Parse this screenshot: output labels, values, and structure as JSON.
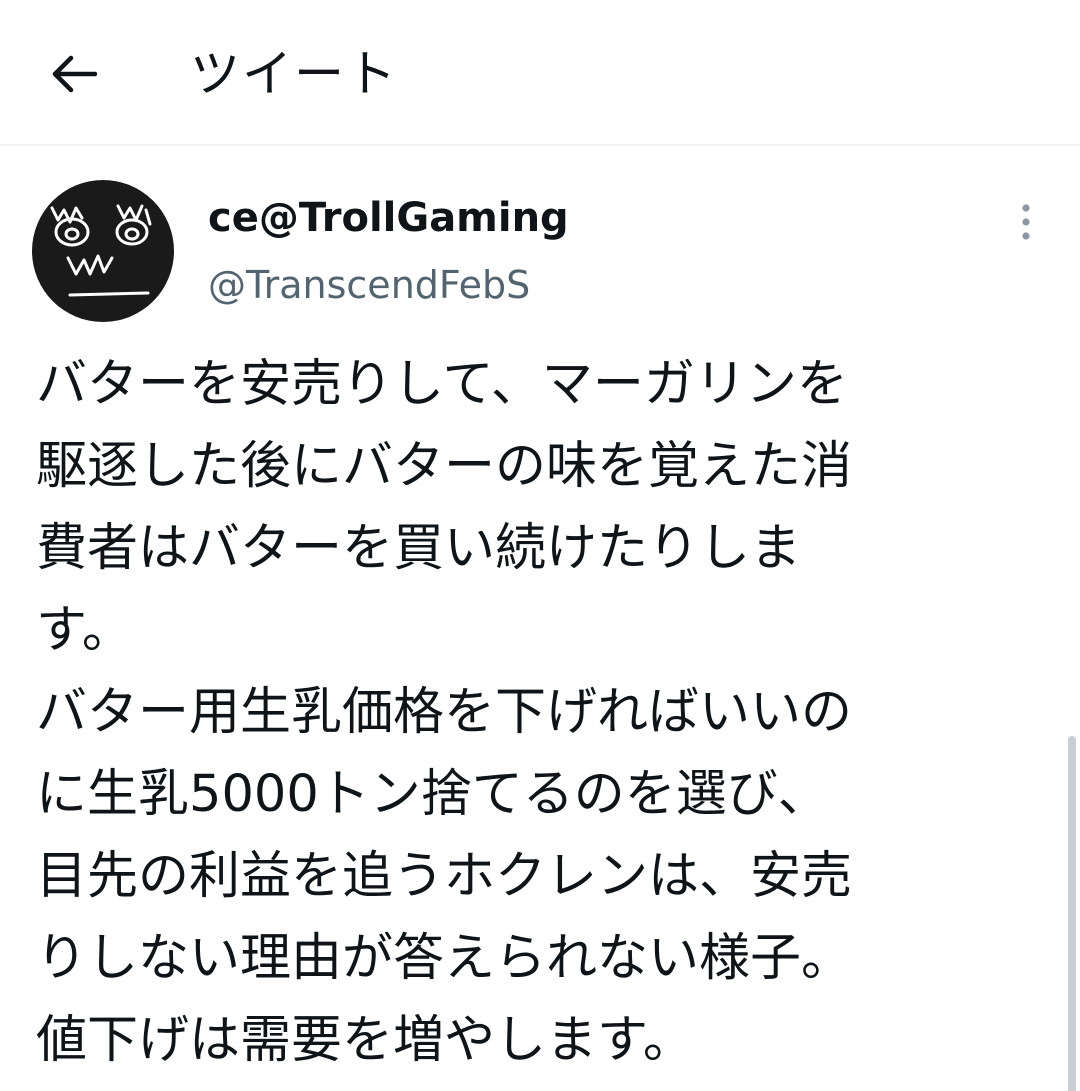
{
  "header": {
    "back_icon": "arrow-left-icon",
    "title": "ツイート"
  },
  "tweet": {
    "author": {
      "display_name": "ce@TrollGaming",
      "handle": "@TranscendFebS",
      "avatar_icon": "doodle-face-avatar"
    },
    "more_icon": "more-vertical-icon",
    "body_lines": [
      "バターを安売りして、マーガリンを",
      "駆逐した後にバターの味を覚えた消",
      "費者はバターを買い続けたりしま",
      "す。",
      "バター用生乳価格を下げればいいの",
      "に生乳5000トン捨てるのを選び、",
      "目先の利益を追うホクレンは、安売",
      "りしない理由が答えられない様子。",
      "値下げは需要を増やします。"
    ]
  },
  "colors": {
    "text": "#0f1419",
    "secondary": "#536471",
    "divider": "#eff3f4",
    "avatar_bg": "#1a1a1a"
  }
}
